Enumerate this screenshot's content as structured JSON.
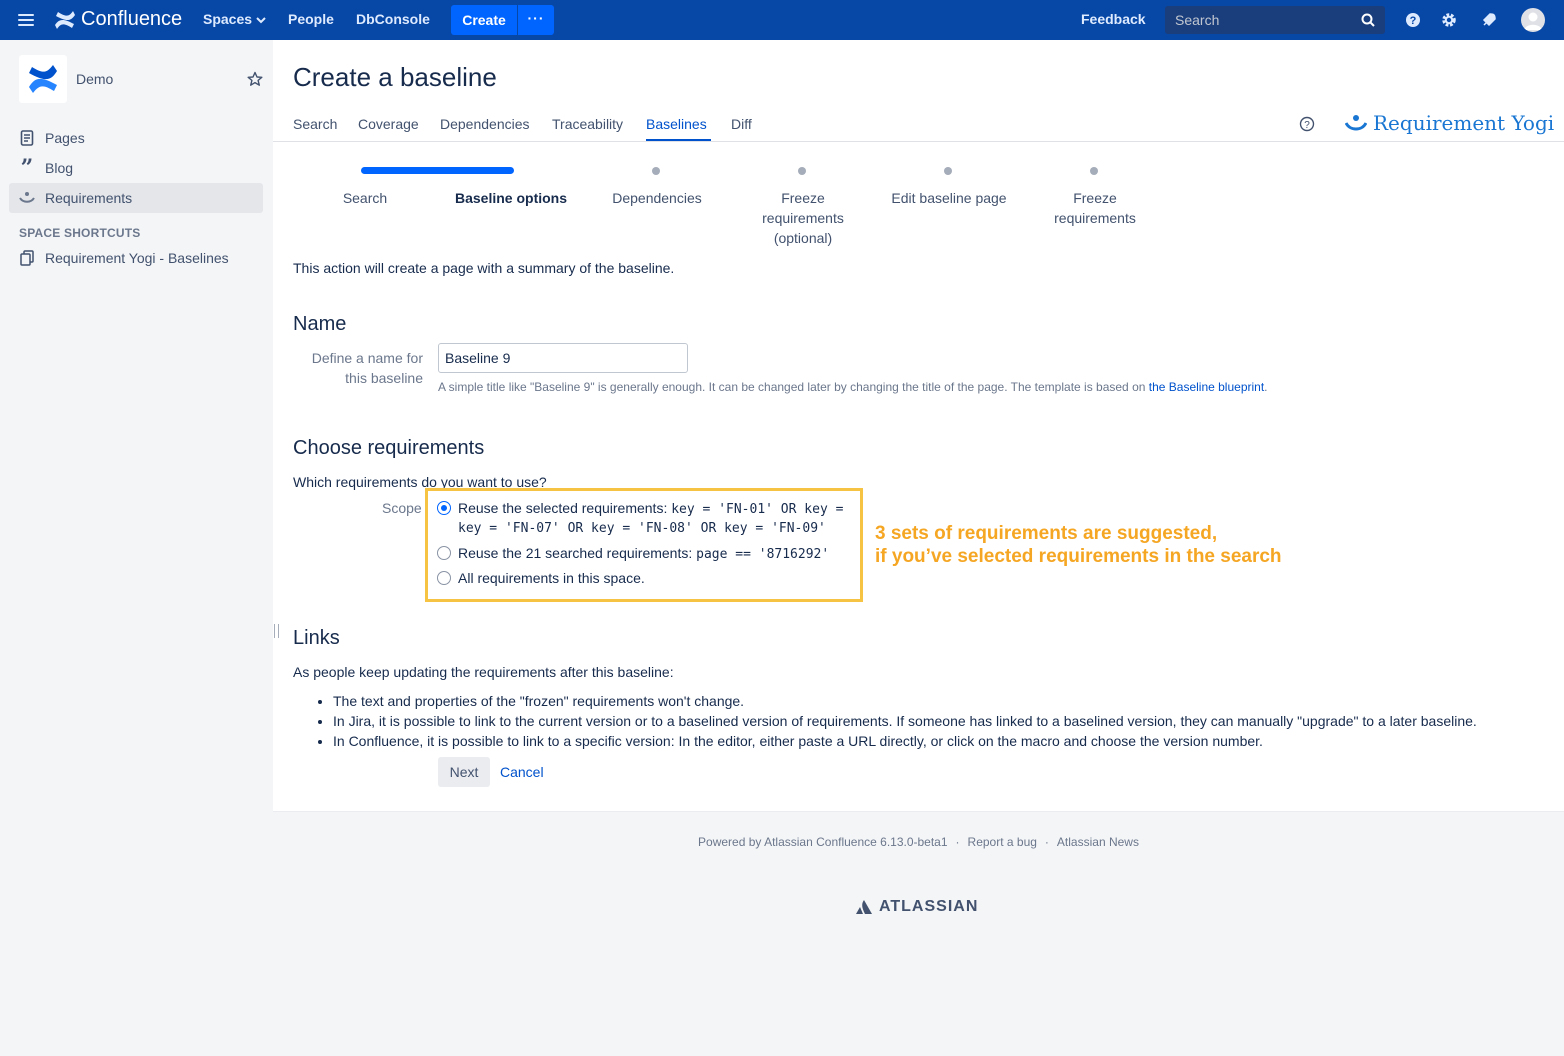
{
  "topnav": {
    "brand": "Confluence",
    "spaces": "Spaces",
    "people": "People",
    "dbconsole": "DbConsole",
    "create": "Create",
    "more": "···",
    "feedback": "Feedback",
    "search_placeholder": "Search"
  },
  "sidebar": {
    "space_name": "Demo",
    "items": [
      {
        "label": "Pages",
        "icon": "pages-icon"
      },
      {
        "label": "Blog",
        "icon": "quote-icon"
      },
      {
        "label": "Requirements",
        "icon": "requirement-yogi-icon"
      }
    ],
    "shortcuts_header": "SPACE SHORTCUTS",
    "shortcut": "Requirement Yogi - Baselines"
  },
  "main": {
    "title": "Create a baseline",
    "tabs": [
      "Search",
      "Coverage",
      "Dependencies",
      "Traceability",
      "Baselines",
      "Diff"
    ],
    "active_tab": "Baselines",
    "product_logo": "Requirement Yogi",
    "wizard": {
      "steps": [
        "Search",
        "Baseline options",
        "Dependencies",
        "Freeze requirements (optional)",
        "Edit baseline page",
        "Freeze requirements"
      ],
      "active_step": "Baseline options",
      "step4_lines": [
        "Freeze",
        "requirements",
        "(optional)"
      ],
      "step6_lines": [
        "Freeze",
        "requirements"
      ]
    },
    "intro": "This action will create a page with a summary of the baseline.",
    "name_section": {
      "heading": "Name",
      "label_line1": "Define a name for",
      "label_line2": "this baseline",
      "value": "Baseline 9",
      "hint_prefix": "A simple title like \"Baseline 9\" is generally enough. It can be changed later by changing the title of the page. The template is based on ",
      "hint_link": "the Baseline blueprint",
      "hint_suffix": "."
    },
    "requirements_section": {
      "heading": "Choose requirements",
      "question": "Which requirements do you want to use?",
      "scope_label": "Scope",
      "option1_prefix": "Reuse the selected requirements: ",
      "option1_query_line1": "key = 'FN-01' OR key =",
      "option1_query_line2": "key = 'FN-07' OR key = 'FN-08' OR key = 'FN-09'",
      "option2_prefix": "Reuse the 21 searched requirements: ",
      "option2_query": "page == '8716292'",
      "option3": "All requirements in this space.",
      "selected_option": 1
    },
    "annotation_line1": "3 sets of requirements are suggested,",
    "annotation_line2": "if you’ve selected requirements in the search",
    "links_section": {
      "heading": "Links",
      "intro": "As people keep updating the requirements after this baseline:",
      "bullets": [
        "The text and properties of the \"frozen\" requirements won't change.",
        "In Jira, it is possible to link to the current version or to a baselined version of requirements. If someone has linked to a baselined version, they can manually \"upgrade\" to a later baseline.",
        "In Confluence, it is possible to link to a specific version: In the editor, either paste a URL directly, or click on the macro and choose the version number."
      ]
    },
    "next": "Next",
    "cancel": "Cancel"
  },
  "footer": {
    "powered": "Powered by Atlassian Confluence 6.13.0-beta1",
    "sep": "·",
    "report": "Report a bug",
    "news": "Atlassian News",
    "atlassian": "ATLASSIAN"
  },
  "colors": {
    "topnav": "#0747a6",
    "accent": "#0052cc",
    "highlight": "#f6c342",
    "annotation": "#f5a623"
  }
}
